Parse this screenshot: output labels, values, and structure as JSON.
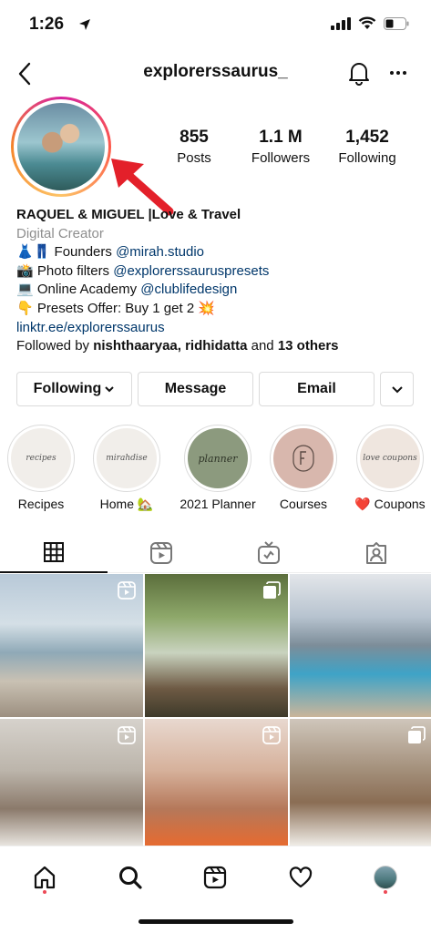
{
  "status_bar": {
    "time": "1:26"
  },
  "header": {
    "username": "explorerssaurus_"
  },
  "profile": {
    "stats": [
      {
        "value": "855",
        "label": "Posts"
      },
      {
        "value": "1.1 M",
        "label": "Followers"
      },
      {
        "value": "1,452",
        "label": "Following"
      }
    ],
    "bio": {
      "name": "RAQUEL & MIGUEL |Love & Travel",
      "category": "Digital Creator",
      "line1_emoji": "👗👖",
      "line1_text": " Founders ",
      "line1_tag": "@mirah.studio",
      "line2_emoji": "📸",
      "line2_text": " Photo filters ",
      "line2_tag": "@explorerssauruspresets",
      "line3_emoji": "💻",
      "line3_text": " Online Academy ",
      "line3_tag": "@clublifedesign",
      "line4_emoji": "👇",
      "line4_text": " Presets Offer: Buy 1 get 2 ",
      "line4_emoji_end": "💥",
      "link": "linktr.ee/explorerssaurus",
      "followed_by_prefix": "Followed by ",
      "followed_by_names": "nishthaaryaa, ridhidatta",
      "followed_by_and": " and ",
      "followed_by_others": "13 others"
    }
  },
  "buttons": {
    "following": "Following",
    "message": "Message",
    "email": "Email"
  },
  "highlights": [
    {
      "label": "Recipes",
      "cover_text": "recipes",
      "color": "#f1eeea"
    },
    {
      "label": "Home 🏡",
      "cover_text": "mirahdise",
      "color": "#f1eeea"
    },
    {
      "label": "2021 Planner",
      "cover_text": "planner",
      "color": "#8c9a7e"
    },
    {
      "label": "Courses",
      "cover_text": "",
      "color": "#d8b7ad"
    },
    {
      "label": "❤️ Coupons",
      "cover_text": "love coupons",
      "color": "#efe6df"
    }
  ],
  "tabs": [
    "grid-icon",
    "reels-icon",
    "igtv-icon",
    "tagged-icon"
  ],
  "accent_colors": {
    "link": "#00376b",
    "notification_dot": "#ed4956",
    "arrow": "#e3202a"
  }
}
